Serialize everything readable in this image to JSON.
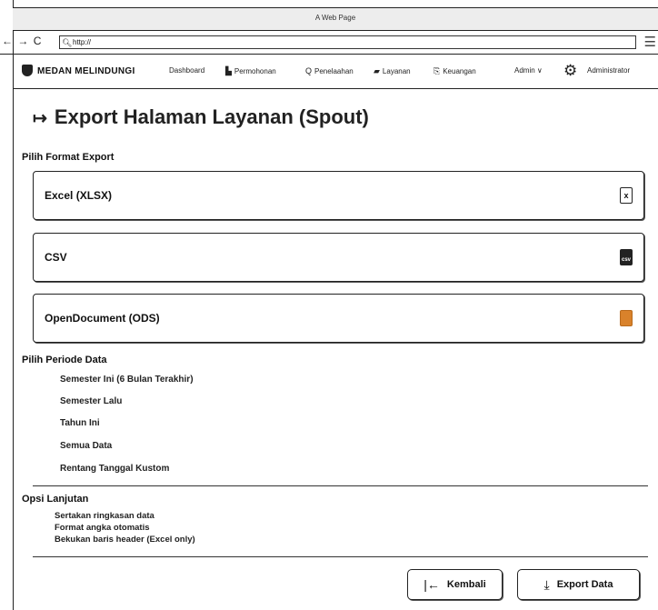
{
  "window": {
    "title": "A Web Page"
  },
  "browser": {
    "back": "←",
    "forward": "→",
    "reload": "C",
    "url": "http://"
  },
  "nav": {
    "brand": "MEDAN MELINDUNGI",
    "items": [
      {
        "label": "Dashboard",
        "icon": ""
      },
      {
        "label": "Permohonan",
        "icon": "▙"
      },
      {
        "label": "Penelaahan",
        "icon": "Q"
      },
      {
        "label": "Layanan",
        "icon": "▰"
      },
      {
        "label": "Keuangan",
        "icon": "⎘"
      }
    ],
    "admin": "Admin",
    "admin_caret": "∨",
    "settings_icon": "⚙",
    "administrator": "Administrator"
  },
  "page": {
    "title": "Export Halaman Layanan (Spout)",
    "title_icon": "↦",
    "format_label": "Pilih Format Export",
    "formats": [
      {
        "label": "Excel (XLSX)",
        "icon": "x"
      },
      {
        "label": "CSV",
        "icon": "csv"
      },
      {
        "label": "OpenDocument (ODS)",
        "icon": ""
      }
    ],
    "period_label": "Pilih Periode Data",
    "periods": [
      "Semester Ini (6 Bulan Terakhir)",
      "Semester Lalu",
      "Tahun Ini",
      "Semua Data",
      "Rentang Tanggal Kustom"
    ],
    "advanced_label": "Opsi Lanjutan",
    "options": [
      "Sertakan ringkasan data",
      "Format angka otomatis",
      "Bekukan baris header (Excel only)"
    ],
    "back_button": "Kembali",
    "back_icon": "|←",
    "export_button": "Export Data",
    "export_icon": "⤓"
  }
}
